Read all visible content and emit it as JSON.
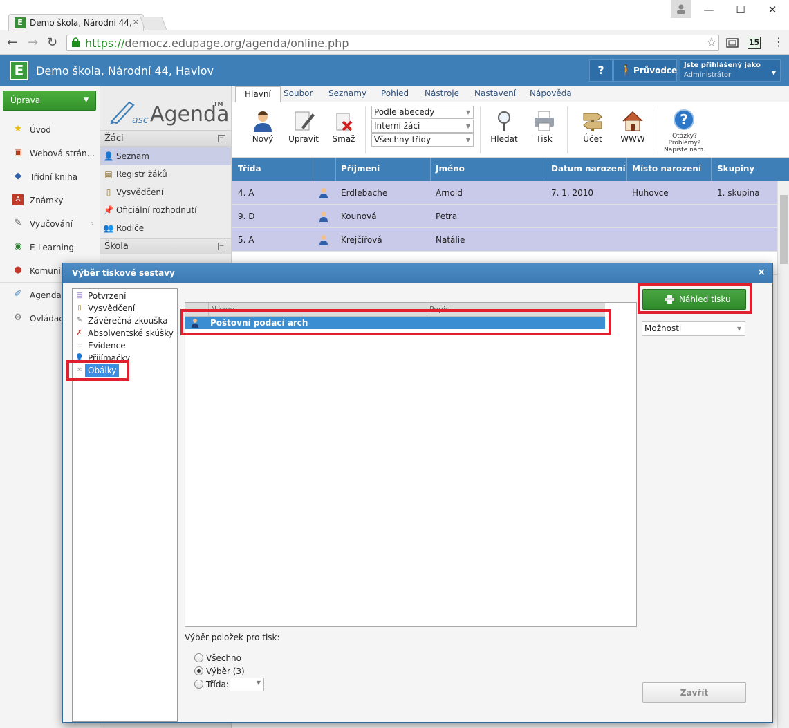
{
  "browser": {
    "tab_title": "Demo škola, Národní 44, H",
    "tab_close": "×",
    "url_scheme": "https://",
    "url_rest": "democz.edupage.org/agenda/online.php",
    "ext_badge": "15",
    "win_min": "—",
    "win_max": "☐",
    "win_close": "✕"
  },
  "app": {
    "logo": "E",
    "school_name": "Demo škola, Národní 44, Havlov",
    "help": "?",
    "guide": "Průvodce",
    "logged_as": "Jste přihlášený jako",
    "user_role": "Administrátor"
  },
  "leftnav": {
    "edit_button": "Úprava",
    "items": [
      "Úvod",
      "Webová strán...",
      "Třídní kniha",
      "Známky",
      "Vyučování",
      "E-Learning",
      "Komunik",
      "Agenda",
      "Ovládac"
    ]
  },
  "midpanel": {
    "logo_asc": "asc",
    "logo_word": "Agenda",
    "logo_tm": "TM",
    "section_students": "Žáci",
    "items": [
      "Seznam",
      "Registr žáků",
      "Vysvědčení",
      "Oficiální rozhodnutí",
      "Rodiče"
    ],
    "section_school": "Škola"
  },
  "ribbon": {
    "tabs": [
      "Hlavní",
      "Soubor",
      "Seznamy",
      "Pohled",
      "Nástroje",
      "Nastavení",
      "Nápověda"
    ],
    "btn_new": "Nový",
    "btn_edit": "Upravit",
    "btn_delete": "Smaž",
    "select_sort": "Podle abecedy",
    "select_type": "Interní žáci",
    "select_class": "Všechny třídy",
    "btn_find": "Hledat",
    "btn_print": "Tisk",
    "btn_account": "Účet",
    "btn_www": "WWW",
    "help_line1": "Otázky?",
    "help_line2": "Problémy?",
    "help_line3": "Napište nám."
  },
  "grid": {
    "headers": [
      "Třída",
      "Příjmení",
      "Jméno",
      "Datum narození",
      "Místo narození",
      "Skupiny"
    ],
    "rows": [
      {
        "class": "4. A",
        "surname": "Erdlebache",
        "name": "Arnold",
        "dob": "7. 1. 2010",
        "pob": "Huhovce",
        "group": "1. skupina"
      },
      {
        "class": "9. D",
        "surname": "Kounová",
        "name": "Petra",
        "dob": "",
        "pob": "",
        "group": ""
      },
      {
        "class": "5. A",
        "surname": "Krejčířová",
        "name": "Natálie",
        "dob": "",
        "pob": "",
        "group": ""
      }
    ]
  },
  "modal": {
    "title": "Výběr tiskové sestavy",
    "close": "×",
    "categories": [
      "Potvrzení",
      "Vysvědčení",
      "Závěrečná zkouška",
      "Absolventské skúšky",
      "Evidence",
      "Přijímačky",
      "Obálky"
    ],
    "list_header_name": "Název",
    "list_header_desc": "Popis",
    "report_item": "Poštovní podací arch",
    "selection_label": "Výběr položek pro tisk:",
    "radio_all": "Všechno",
    "radio_selection": "Výběr (3)",
    "radio_class": "Třída:",
    "preview_button": "Náhled tisku",
    "options": "Možnosti",
    "close_button": "Zavřít"
  },
  "colors": {
    "header_blue": "#3f7fb7",
    "accent_green": "#3a9c3a",
    "highlight_red": "#e0202e",
    "selection_blue": "#3b8ed1"
  }
}
